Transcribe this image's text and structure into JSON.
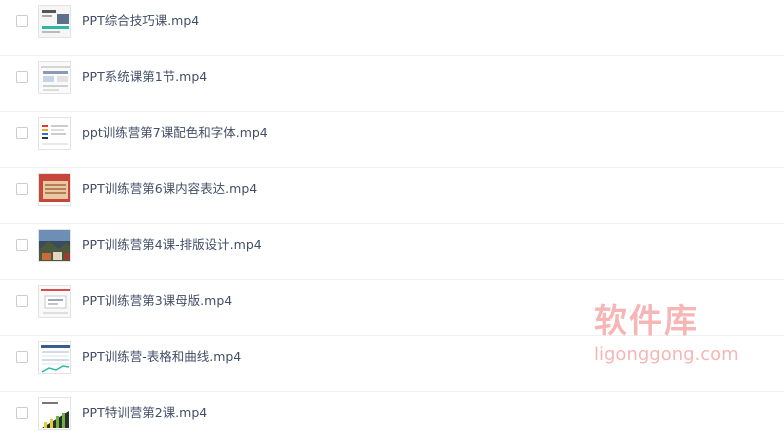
{
  "files": [
    {
      "name": "PPT综合技巧课.mp4",
      "thumbnail": "slide-thumbnail"
    },
    {
      "name": "PPT系统课第1节.mp4",
      "thumbnail": "slide-thumbnail"
    },
    {
      "name": "ppt训练营第7课配色和字体.mp4",
      "thumbnail": "slide-thumbnail"
    },
    {
      "name": "PPT训练营第6课内容表达.mp4",
      "thumbnail": "slide-thumbnail"
    },
    {
      "name": "PPT训练营第4课-排版设计.mp4",
      "thumbnail": "slide-thumbnail"
    },
    {
      "name": "PPT训练营第3课母版.mp4",
      "thumbnail": "slide-thumbnail"
    },
    {
      "name": "PPT训练营-表格和曲线.mp4",
      "thumbnail": "slide-thumbnail"
    },
    {
      "name": "PPT特训营第2课.mp4",
      "thumbnail": "slide-thumbnail"
    }
  ],
  "watermark": {
    "title": "软件库",
    "url": "ligonggong.com"
  },
  "colors": {
    "file_name_text": "#424e67",
    "row_divider": "#eef0f4",
    "watermark": "#f7b6b6"
  }
}
